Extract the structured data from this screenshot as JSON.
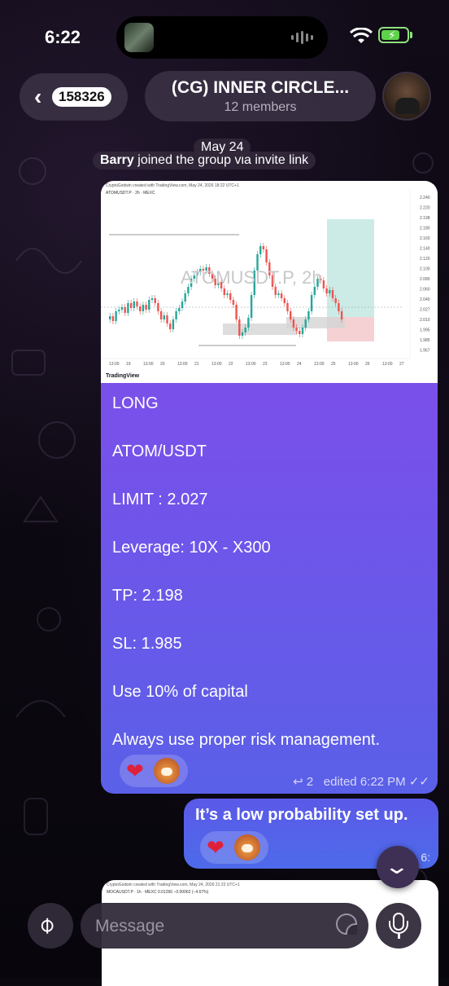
{
  "status_bar": {
    "time": "6:22"
  },
  "header": {
    "back_count": "158326",
    "title": "(CG) INNER CIRCLE...",
    "subtitle": "12 members"
  },
  "service": {
    "date": "May 24",
    "join_user": "Barry",
    "join_text": " joined the group via invite link"
  },
  "post": {
    "chart": {
      "header_text": "CryptoGodwin created with TradingView.com, May 24, 2026 18:22 UTC+1",
      "pair_text": "ATOMUSDT.P · 2h · MEXC",
      "watermark": "ATOMUSDT.P, 2h",
      "price_labels": [
        "2.240",
        "2.220",
        "2.198",
        "2.180",
        "2.160",
        "2.140",
        "2.120",
        "2.100",
        "2.080",
        "2.060",
        "2.040",
        "2.027",
        "2.010",
        "1.995",
        "1.985",
        "1.967"
      ],
      "time_labels": [
        "13:00",
        "19",
        "13:00",
        "20",
        "13:00",
        "21",
        "13:00",
        "22",
        "13:00",
        "23",
        "13:00",
        "24",
        "13:00",
        "25",
        "13:00",
        "26",
        "13:00",
        "27"
      ],
      "logo_text": "TradingView"
    },
    "lines": [
      "LONG",
      "ATOM/USDT",
      "LIMIT : 2.027",
      "Leverage: 10X - X300",
      "TP: 2.198",
      "SL: 1.985",
      "Use 10% of capital",
      "Always use proper risk management."
    ],
    "reaction": "❤",
    "replies": "2",
    "edited": "edited 6:22 PM"
  },
  "own_message": {
    "text": "It’s a low probability set up.",
    "reaction": "❤",
    "time": "6:"
  },
  "next_post": {
    "header_text": "CryptoGodwin created with TradingView.com, May 24, 2026 21:22 UTC+1",
    "pair_text": "MOCAUSDT.P · 1h · MEXC  0.01266  −0.00062 (−4.67%)"
  },
  "composer": {
    "placeholder": "Message"
  }
}
